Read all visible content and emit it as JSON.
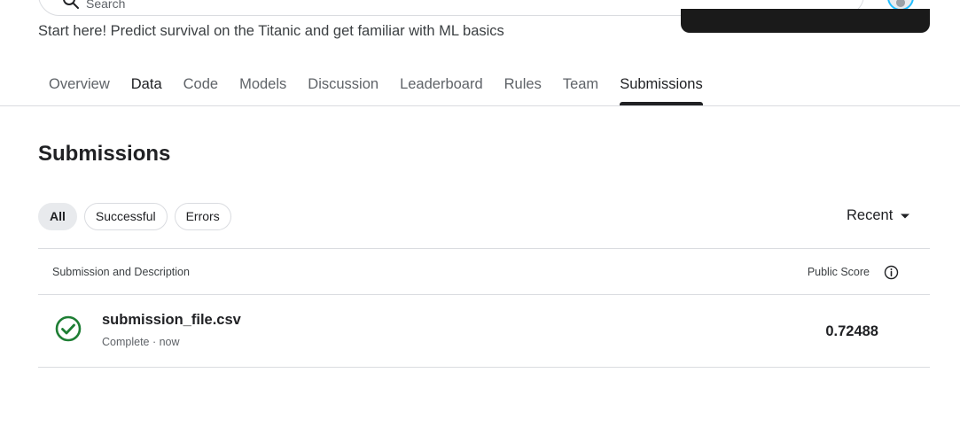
{
  "search": {
    "placeholder": "Search"
  },
  "header": {
    "subtitle": "Start here! Predict survival on the Titanic and get familiar with ML basics"
  },
  "tabs": [
    {
      "label": "Overview"
    },
    {
      "label": "Data"
    },
    {
      "label": "Code"
    },
    {
      "label": "Models"
    },
    {
      "label": "Discussion"
    },
    {
      "label": "Leaderboard"
    },
    {
      "label": "Rules"
    },
    {
      "label": "Team"
    },
    {
      "label": "Submissions",
      "active": true
    }
  ],
  "page": {
    "title": "Submissions"
  },
  "filters": {
    "all": "All",
    "successful": "Successful",
    "errors": "Errors",
    "selected": "All"
  },
  "sort": {
    "label": "Recent",
    "icon": "dropdown-arrow-icon"
  },
  "table": {
    "columns": {
      "description": "Submission and Description",
      "score": "Public Score"
    },
    "rows": [
      {
        "file_name": "submission_file.csv",
        "meta": "Complete · now",
        "score": "0.72488",
        "status": "complete",
        "status_icon": "check-circle-icon"
      }
    ]
  },
  "colors": {
    "text_primary": "#202124",
    "text_secondary": "#5f6368",
    "divider": "#dadce0",
    "success": "#1e7e34",
    "chip_selected_bg": "#e8eaed",
    "avatar_ring": "#20beff"
  }
}
